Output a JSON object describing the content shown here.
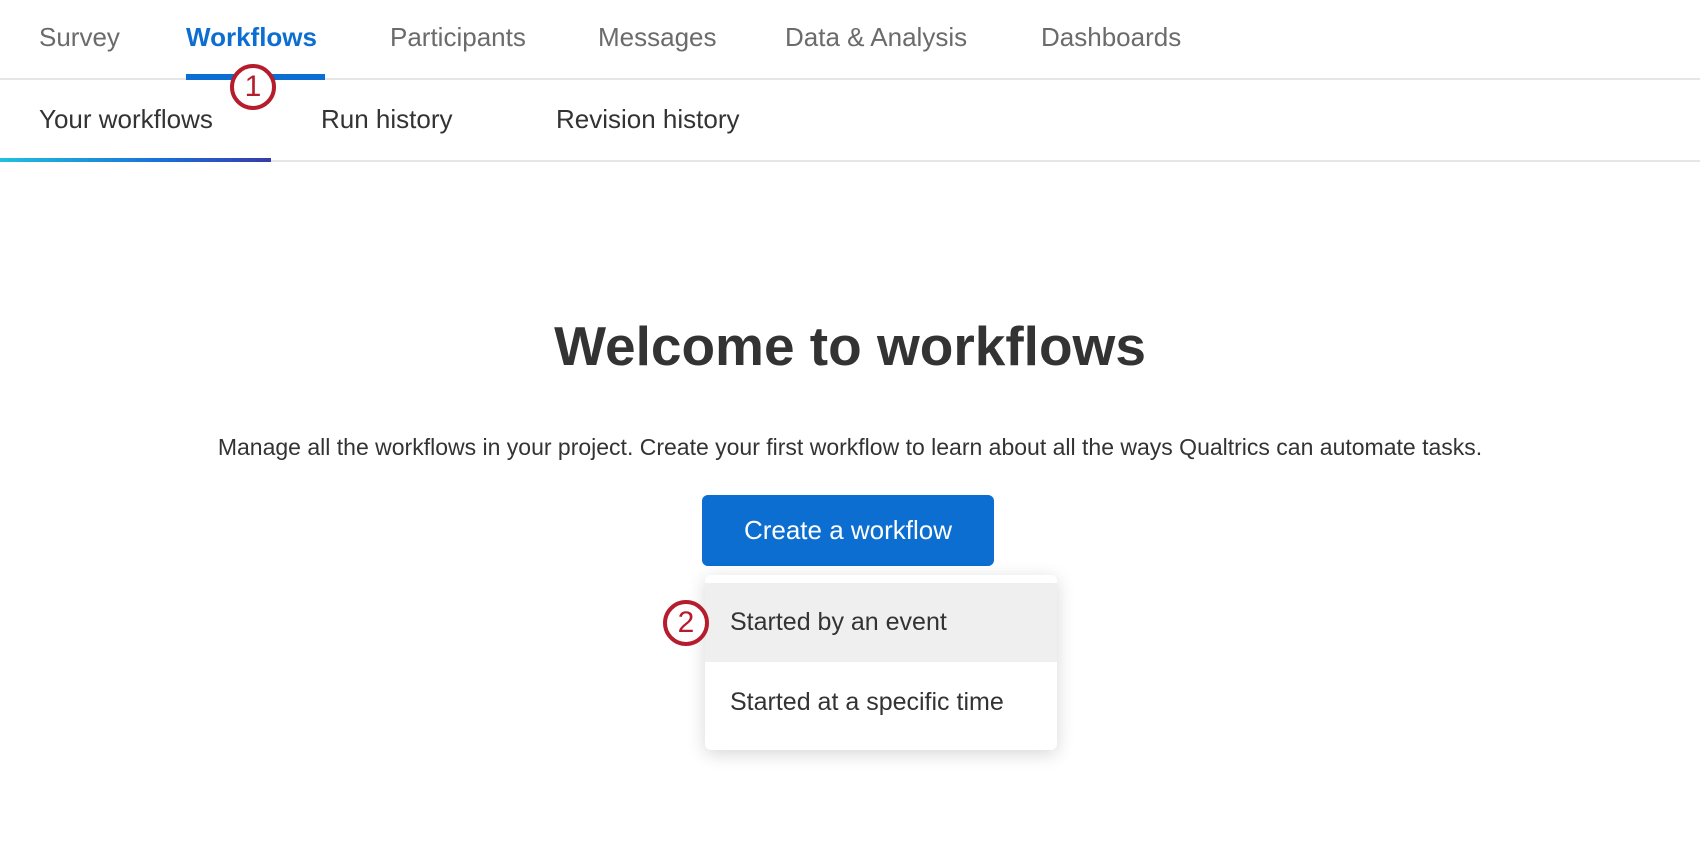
{
  "top_tabs": [
    {
      "label": "Survey"
    },
    {
      "label": "Workflows",
      "active": true
    },
    {
      "label": "Participants"
    },
    {
      "label": "Messages"
    },
    {
      "label": "Data & Analysis"
    },
    {
      "label": "Dashboards"
    }
  ],
  "sub_tabs": [
    {
      "label": "Your workflows",
      "active": true
    },
    {
      "label": "Run history"
    },
    {
      "label": "Revision history"
    }
  ],
  "main": {
    "title": "Welcome to workflows",
    "description": "Manage all the workflows in your project. Create your first workflow to learn about all the ways Qualtrics can automate tasks.",
    "create_button": "Create a workflow",
    "menu_items": [
      {
        "label": "Started by an event",
        "highlighted": true
      },
      {
        "label": "Started at a specific time"
      }
    ]
  },
  "annotations": {
    "step1": "1",
    "step2": "2"
  },
  "colors": {
    "accent": "#0b6ed0",
    "annotation": "#b51c2c"
  }
}
